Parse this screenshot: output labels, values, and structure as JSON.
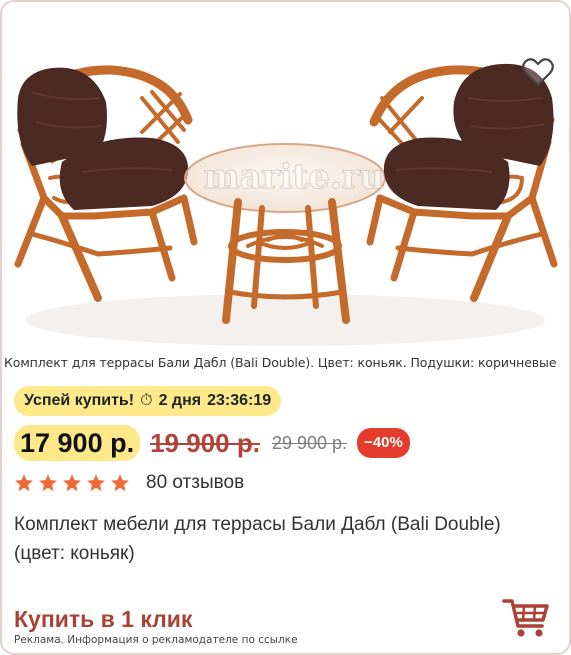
{
  "product": {
    "image_caption": "Комплект для террасы Бали Дабл (Bali Double). Цвет: коньяк. Подушки: коричневые",
    "watermark": "marite.ru",
    "favorite_icon": "heart-outline-icon",
    "timer": {
      "label": "Успей купить!",
      "clock_icon": "stopwatch-icon",
      "days": "2 дня",
      "hours": "23",
      "minutes": "36",
      "seconds": "19"
    },
    "price": {
      "current": "17 900 р.",
      "old": "19 900 р.",
      "older": "29 900 р.",
      "discount": "−40%"
    },
    "rating": {
      "stars_value": 5,
      "stars_max": 5,
      "reviews": "80 отзывов"
    },
    "title": "Комплект мебели для террасы Бали Дабл (Bali Double) (цвет: коньяк)",
    "buy_one_click": "Купить в 1 клик",
    "ad_notice": "Реклама. Информация о рекламодателе по ссылке",
    "cart_icon": "cart-icon"
  },
  "colors": {
    "badge_yellow": "#fde98a",
    "old_price_red": "#b3433a",
    "discount_red": "#e53b2d",
    "star_orange": "#ee6a3a",
    "accent_brown": "#a94434",
    "rattan": "#c46a2b",
    "cushion": "#4a2a22"
  }
}
